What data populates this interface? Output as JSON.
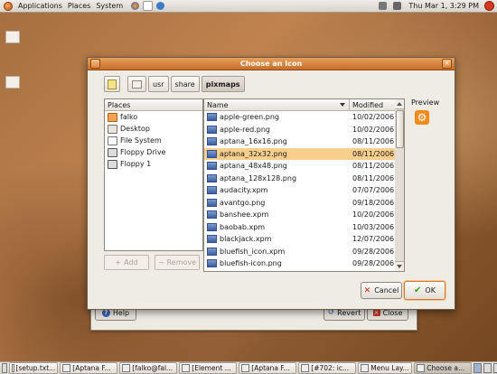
{
  "top_panel": {
    "menus": [
      "Applications",
      "Places",
      "System"
    ],
    "clock": "Thu Mar  1,  3:29 PM"
  },
  "dialog": {
    "title": "Choose an Icon",
    "path_buttons": [
      "usr",
      "share",
      "pixmaps"
    ],
    "places": {
      "header": "Places",
      "items": [
        "falko",
        "Desktop",
        "File System",
        "Floppy Drive",
        "Floppy 1"
      ],
      "add_label": "Add",
      "remove_label": "Remove"
    },
    "files": {
      "name_header": "Name",
      "modified_header": "Modified",
      "rows": [
        {
          "name": "apple-green.png",
          "date": "10/02/2006"
        },
        {
          "name": "apple-red.png",
          "date": "10/02/2006"
        },
        {
          "name": "aptana_16x16.png",
          "date": "08/11/2006"
        },
        {
          "name": "aptana_32x32.png",
          "date": "08/11/2006"
        },
        {
          "name": "aptana_48x48.png",
          "date": "08/11/2006"
        },
        {
          "name": "aptana_128x128.png",
          "date": "08/11/2006"
        },
        {
          "name": "audacity.xpm",
          "date": "07/07/2006"
        },
        {
          "name": "avantgo.png",
          "date": "09/18/2006"
        },
        {
          "name": "banshee.xpm",
          "date": "10/20/2006"
        },
        {
          "name": "baobab.xpm",
          "date": "10/03/2006"
        },
        {
          "name": "blackjack.xpm",
          "date": "12/07/2006"
        },
        {
          "name": "bluefish_icon.xpm",
          "date": "09/28/2006"
        },
        {
          "name": "bluefish-icon.png",
          "date": "09/28/2006"
        }
      ],
      "selected_index": 3
    },
    "preview_label": "Preview",
    "cancel_label": "Cancel",
    "ok_label": "OK"
  },
  "background_window": {
    "help_label": "Help",
    "revert_label": "Revert",
    "close_label": "Close"
  },
  "taskbar": {
    "tasks": [
      "[setup.txt...",
      "[Aptana F...",
      "[falko@fal...",
      "[Element ...",
      "[Aptana F...",
      "[#702: ic...",
      "Menu Lay...",
      "Choose a..."
    ]
  }
}
